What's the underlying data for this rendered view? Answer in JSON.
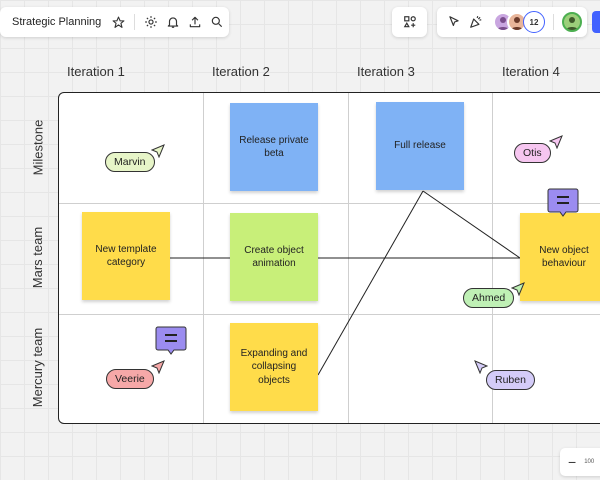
{
  "board": {
    "title": "Strategic Planning"
  },
  "toolbar": {
    "left_icons": [
      "star-icon",
      "settings-icon",
      "bell-icon",
      "upload-icon",
      "search-icon"
    ],
    "mid_icon": "shapes-icon",
    "right_icons": [
      "cursor-icon",
      "celebrate-icon"
    ],
    "collaborator_count": "12"
  },
  "columns": [
    "Iteration 1",
    "Iteration 2",
    "Iteration 3",
    "Iteration 4"
  ],
  "rows": [
    "Milestone",
    "Mars team",
    "Mercury team"
  ],
  "stickies": {
    "release_beta": "Release private beta",
    "full_release": "Full release",
    "new_template": "New template category",
    "create_animation": "Create object animation",
    "new_behaviour": "New object behaviour",
    "expanding": "Expanding and collapsing objects"
  },
  "cursors": {
    "marvin": "Marvin",
    "otis": "Otis",
    "ahmed": "Ahmed",
    "veerie": "Veerie",
    "ruben": "Ruben"
  },
  "zoom": {
    "value": "100"
  },
  "colors": {
    "sticky_blue": "#7fb2f5",
    "sticky_yellow": "#ffdc4a",
    "sticky_green": "#c8ef79",
    "comment_purple": "#9b8cf0",
    "accent": "#4262ff"
  }
}
